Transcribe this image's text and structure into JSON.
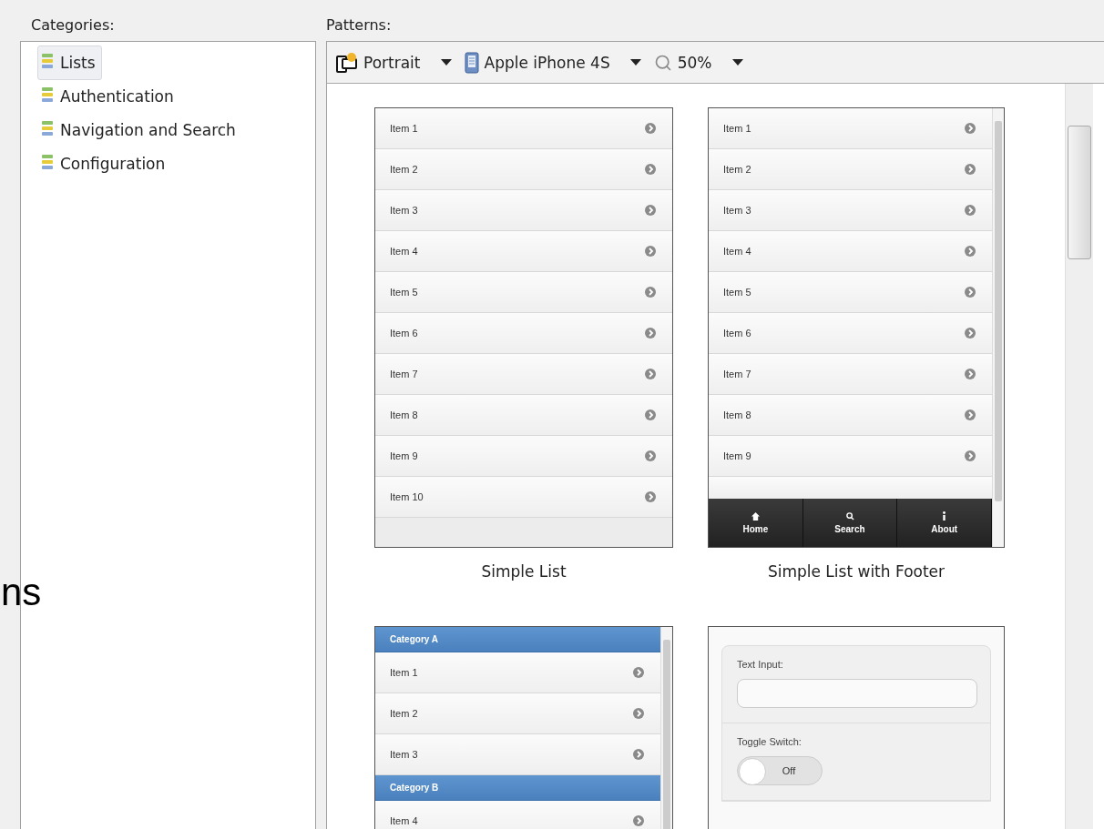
{
  "categories_label": "Categories:",
  "categories": [
    {
      "label": "Lists",
      "selected": true
    },
    {
      "label": "Authentication",
      "selected": false
    },
    {
      "label": "Navigation and Search",
      "selected": false
    },
    {
      "label": "Configuration",
      "selected": false
    }
  ],
  "patterns_label": "Patterns:",
  "toolbar": [
    {
      "kind": "orientation",
      "label": "Portrait"
    },
    {
      "kind": "device",
      "label": "Apple iPhone 4S"
    },
    {
      "kind": "zoom",
      "label": "50%"
    }
  ],
  "patterns": [
    {
      "kind": "list",
      "caption": "Simple List",
      "items": [
        "Item 1",
        "Item 2",
        "Item 3",
        "Item 4",
        "Item 5",
        "Item 6",
        "Item 7",
        "Item 8",
        "Item 9",
        "Item 10"
      ]
    },
    {
      "kind": "list_footer",
      "caption": "Simple List with Footer",
      "items": [
        "Item 1",
        "Item 2",
        "Item 3",
        "Item 4",
        "Item 5",
        "Item 6",
        "Item 7",
        "Item 8",
        "Item 9"
      ],
      "footer": [
        {
          "kind": "home",
          "label": "Home"
        },
        {
          "kind": "search",
          "label": "Search"
        },
        {
          "kind": "about",
          "label": "About"
        }
      ]
    },
    {
      "kind": "grouped_list",
      "sections": [
        {
          "header": "Category A",
          "items": [
            "Item 1",
            "Item 2",
            "Item 3"
          ]
        },
        {
          "header": "Category B",
          "items": [
            "Item 4"
          ]
        }
      ]
    },
    {
      "kind": "form",
      "fields": [
        {
          "kind": "text",
          "label": "Text Input:"
        },
        {
          "kind": "toggle",
          "label": "Toggle Switch:",
          "on": false,
          "state_label": "Off"
        }
      ]
    }
  ],
  "overlay_text": "ns"
}
